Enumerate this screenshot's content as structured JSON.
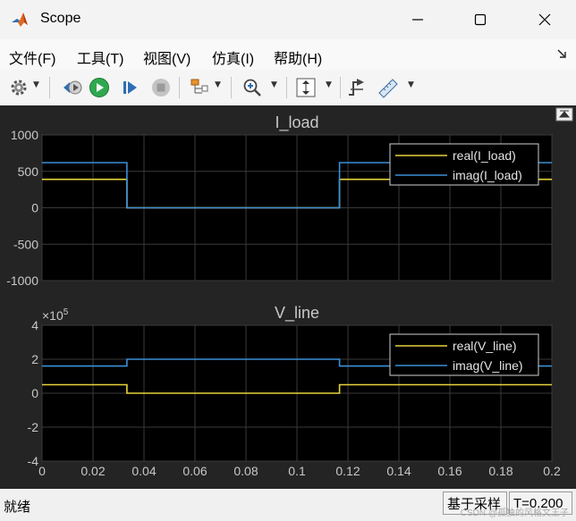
{
  "window": {
    "title": "Scope"
  },
  "menu": [
    "文件(F)",
    "工具(T)",
    "视图(V)",
    "仿真(I)",
    "帮助(H)"
  ],
  "status": {
    "text": "就绪",
    "sample": "基于采样",
    "time": "T=0.200"
  },
  "watermark": "CSDN @孤独的风格文王子",
  "colors": {
    "real": "#e8d33a",
    "imag": "#3a8fd8",
    "plot_bg": "#000000",
    "frame_bg": "#242424"
  },
  "chart_data": [
    {
      "type": "line",
      "title": "I_load",
      "xlim": [
        0,
        0.2
      ],
      "ylim": [
        -1000,
        1000
      ],
      "yticks": [
        -1000,
        -500,
        0,
        500,
        1000
      ],
      "ytick_labels": [
        "-1000",
        "-500",
        "0",
        "500",
        "1000"
      ],
      "grid": true,
      "legend_position": "top-right",
      "series": [
        {
          "name": "real(I_load)",
          "color": "#e8d33a",
          "x": [
            0,
            0.0333,
            0.0333,
            0.1167,
            0.1167,
            0.2
          ],
          "y": [
            390,
            390,
            0,
            0,
            390,
            390
          ]
        },
        {
          "name": "imag(I_load)",
          "color": "#3a8fd8",
          "x": [
            0,
            0.0333,
            0.0333,
            0.1167,
            0.1167,
            0.2
          ],
          "y": [
            620,
            620,
            0,
            0,
            620,
            620
          ]
        }
      ]
    },
    {
      "type": "line",
      "title": "V_line",
      "exponent_label": "×10",
      "exponent_power": "5",
      "xlim": [
        0,
        0.2
      ],
      "ylim": [
        -4,
        4
      ],
      "yticks": [
        -4,
        -2,
        0,
        2,
        4
      ],
      "ytick_labels": [
        "-4",
        "-2",
        "0",
        "2",
        "4"
      ],
      "xticks": [
        0,
        0.02,
        0.04,
        0.06,
        0.08,
        0.1,
        0.12,
        0.14,
        0.16,
        0.18,
        0.2
      ],
      "xtick_labels": [
        "0",
        "0.02",
        "0.04",
        "0.06",
        "0.08",
        "0.1",
        "0.12",
        "0.14",
        "0.16",
        "0.18",
        "0.2"
      ],
      "grid": true,
      "legend_position": "top-right",
      "series": [
        {
          "name": "real(V_line)",
          "color": "#e8d33a",
          "x": [
            0,
            0.0333,
            0.0333,
            0.1167,
            0.1167,
            0.2
          ],
          "y": [
            0.5,
            0.5,
            0,
            0,
            0.5,
            0.5
          ]
        },
        {
          "name": "imag(V_line)",
          "color": "#3a8fd8",
          "x": [
            0,
            0.0333,
            0.0333,
            0.1167,
            0.1167,
            0.2
          ],
          "y": [
            1.6,
            1.6,
            2.0,
            2.0,
            1.6,
            1.6
          ]
        }
      ]
    }
  ]
}
